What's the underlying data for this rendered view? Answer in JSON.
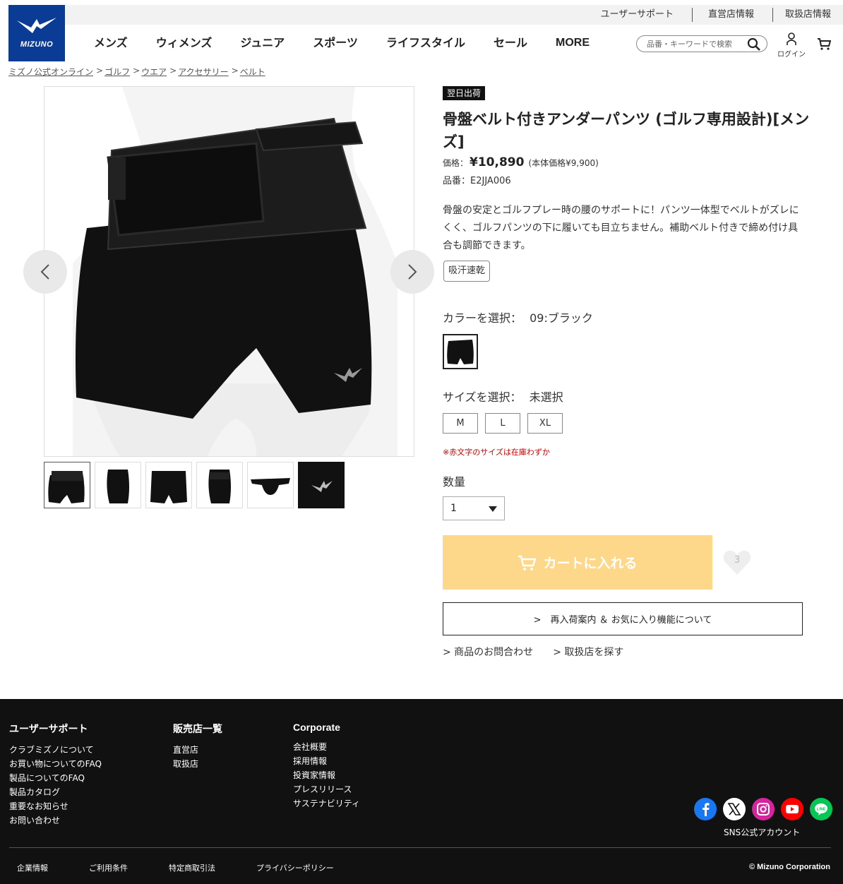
{
  "header": {
    "utility_links": [
      "ユーザーサポート",
      "直営店情報",
      "取扱店情報"
    ],
    "logo_text": "MIZUNO",
    "nav": [
      "メンズ",
      "ウィメンズ",
      "ジュニア",
      "スポーツ",
      "ライフスタイル",
      "セール",
      "MORE"
    ],
    "search_placeholder": "品番・キーワードで検索",
    "login_label": "ログイン"
  },
  "breadcrumb": [
    "ミズノ公式オンライン",
    "ゴルフ",
    "ウエア",
    "アクセサリー",
    "ベルト"
  ],
  "breadcrumb_sep": ">",
  "product": {
    "badge": "翌日出荷",
    "title": "骨盤ベルト付きアンダーパンツ (ゴルフ専用設計)[メンズ]",
    "price_label": "価格：",
    "price": "¥10,890",
    "tax_note": "(本体価格¥9,900)",
    "code": "品番：E2JJA006",
    "description": "骨盤の安定とゴルフプレー時の腰のサポートに！パンツ一体型でベルトがズレにくく、ゴルフパンツの下に履いても目立ちません。補助ベルト付きで締め付け具合も調節できます。",
    "feature_tag": "吸汗速乾",
    "color_label": "カラーを選択：",
    "color_value": "09:ブラック",
    "size_label": "サイズを選択：",
    "size_value": "未選択",
    "sizes": [
      "M",
      "L",
      "XL"
    ],
    "size_note": "※赤文字のサイズは在庫わずか",
    "qty_label": "数量",
    "qty_value": "1",
    "cart_button": "カートに入れる",
    "favorite_count": "3",
    "restock_button": ">　再入荷案内 ＆ お気に入り機能について",
    "inquiry_link": "> 商品のお問合わせ",
    "store_link": "> 取扱店を探す"
  },
  "footer": {
    "col1_title": "ユーザーサポート",
    "col1": [
      "クラブミズノについて",
      "お買い物についてのFAQ",
      "製品についてのFAQ",
      "製品カタログ",
      "重要なお知らせ",
      "お問い合わせ"
    ],
    "col2_title": "販売店一覧",
    "col2": [
      "直営店",
      "取扱店"
    ],
    "col3_title": "Corporate",
    "col3": [
      "会社概要",
      "採用情報",
      "投資家情報",
      "プレスリリース",
      "サステナビリティ"
    ],
    "sns_label": "SNS公式アカウント",
    "legal": [
      "企業情報",
      "ご利用条件",
      "特定商取引法",
      "プライバシーポリシー"
    ],
    "copyright": "© Mizuno Corporation"
  },
  "colors": {
    "brand": "#0a3c96",
    "cart_button": "#fdd88a",
    "footer_bg": "#111111",
    "alert": "#cc0000"
  }
}
